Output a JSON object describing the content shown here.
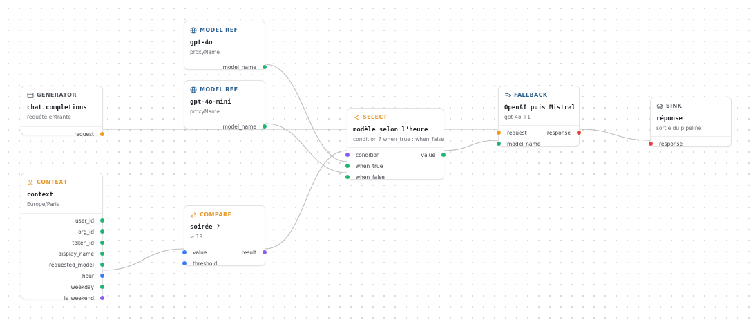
{
  "colors": {
    "model_ref": "#2b5f8f",
    "generator": "#555a61",
    "context": "#e59a2d",
    "compare": "#e59a2d",
    "select": "#e59a2d",
    "fallback": "#2b5f8f",
    "sink": "#555a61",
    "port_green": "#21b573",
    "port_orange": "#f29b16",
    "port_purple": "#8a5cf0",
    "port_blue": "#3b7cf5",
    "port_red": "#e6403a",
    "wire": "#bdbdbd"
  },
  "nodes": {
    "model_ref_1": {
      "kind": "MODEL REF",
      "icon": "globe-icon",
      "title": "gpt-4o",
      "subtitle": "proxyName",
      "outputs": [
        "model_name"
      ]
    },
    "model_ref_2": {
      "kind": "MODEL REF",
      "icon": "globe-icon",
      "title": "gpt-4o-mini",
      "subtitle": "proxyName",
      "outputs": [
        "model_name"
      ]
    },
    "generator": {
      "kind": "GENERATOR",
      "icon": "window-icon",
      "title": "chat.completions",
      "subtitle": "requête entrante",
      "outputs": [
        "request"
      ]
    },
    "context": {
      "kind": "CONTEXT",
      "icon": "user-icon",
      "title": "context",
      "subtitle": "Europe/Paris",
      "outputs": [
        "user_id",
        "org_id",
        "token_id",
        "display_name",
        "requested_model",
        "hour",
        "weekday",
        "is_weekend"
      ]
    },
    "compare": {
      "kind": "COMPARE",
      "icon": "swap-icon",
      "title": "soirée ?",
      "subtitle": "≥ 19",
      "inputs": [
        "value",
        "threshold"
      ],
      "outputs": [
        "result"
      ]
    },
    "select": {
      "kind": "SELECT",
      "icon": "branch-icon",
      "title": "modèle selon l'heure",
      "subtitle": "condition ? when_true : when_false",
      "inputs": [
        "condition",
        "when_true",
        "when_false"
      ],
      "outputs": [
        "value"
      ]
    },
    "fallback": {
      "kind": "FALLBACK",
      "icon": "fallback-icon",
      "title": "OpenAI puis Mistral",
      "subtitle": "gpt-4o +1",
      "inputs": [
        "request",
        "model_name"
      ],
      "outputs": [
        "response"
      ]
    },
    "sink": {
      "kind": "SINK",
      "icon": "layers-icon",
      "title": "réponse",
      "subtitle": "sortie du pipeline",
      "inputs": [
        "response"
      ]
    }
  }
}
